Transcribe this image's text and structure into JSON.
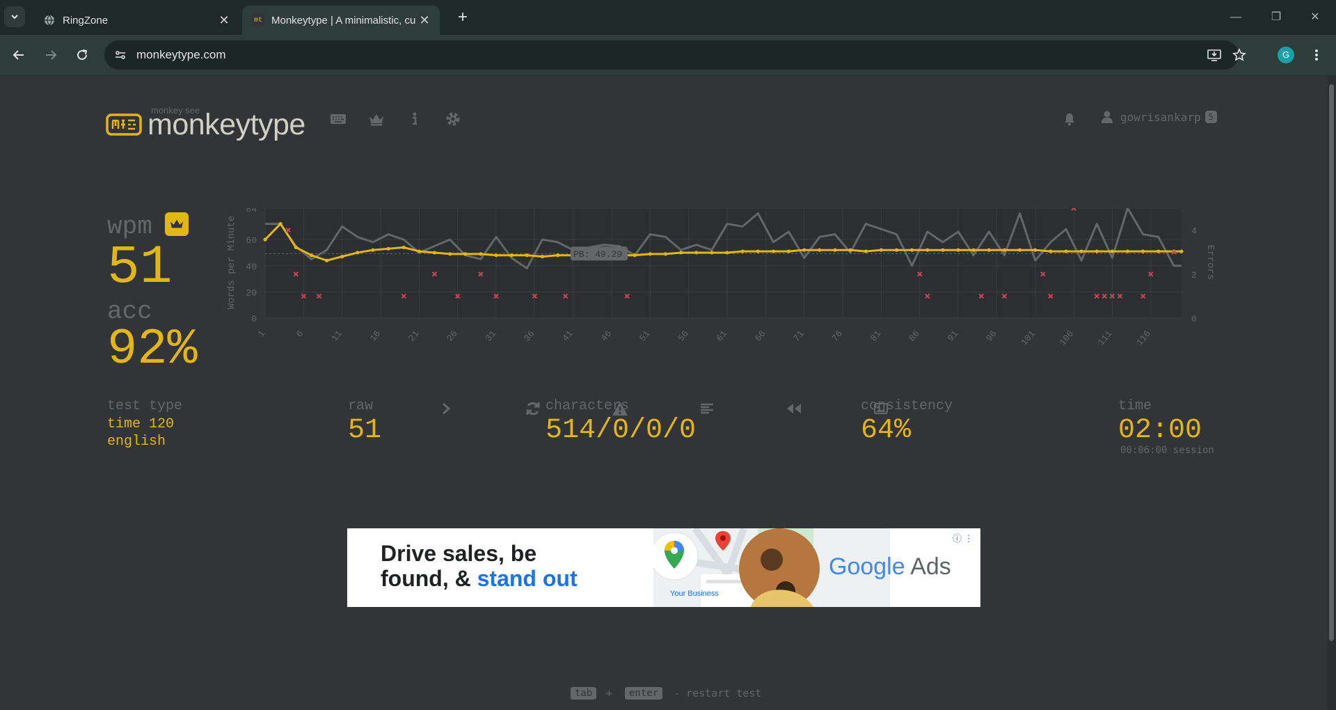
{
  "browser": {
    "tabs": [
      {
        "title": "RingZone",
        "active": false
      },
      {
        "title": "Monkeytype | A minimalistic, cu",
        "active": true,
        "favicon_text": "mt"
      }
    ],
    "new_tab_label": "+",
    "url": "monkeytype.com",
    "profile_initial": "G",
    "window_controls": {
      "minimize": "—",
      "restore": "❐",
      "close": "✕"
    }
  },
  "header": {
    "logo_top": "monkey see",
    "logo_text": "monkeytype",
    "nav_icons": [
      "keyboard-icon",
      "crown-icon",
      "info-icon",
      "gear-icon"
    ],
    "username": "gowrisankarp",
    "level": "5"
  },
  "result": {
    "wpm_label": "wpm",
    "wpm": "51",
    "acc_label": "acc",
    "acc": "92%",
    "test_type_label": "test type",
    "test_type_line1": "time 120",
    "test_type_line2": "english",
    "raw_label": "raw",
    "raw": "51",
    "characters_label": "characters",
    "characters": "514/0/0/0",
    "consistency_label": "consistency",
    "consistency": "64%",
    "time_label": "time",
    "time": "02:00",
    "session": "00:06:00 session"
  },
  "actions": [
    "next-test-icon",
    "restart-icon",
    "warning-icon",
    "words-list-icon",
    "replay-icon",
    "screenshot-icon"
  ],
  "ad": {
    "headline_line1": "Drive sales, be",
    "headline_line2a": "found, & ",
    "headline_line2b": "stand out",
    "your_business": "Your Business",
    "brand_google": "Google",
    "brand_ads": " Ads",
    "info": "ⓘ ⋮"
  },
  "footer": {
    "key1": "tab",
    "plus": "+",
    "key2": "enter",
    "hint": "- restart test"
  },
  "colors": {
    "background": "#323437",
    "main": "#e2b714",
    "sub": "#646669",
    "text": "#d1d0c5",
    "error": "#ca4754",
    "raw_line": "#646669"
  },
  "chart_data": {
    "type": "line",
    "ylabel": "Words per Minute",
    "y2label": "Errors",
    "ylim": [
      0,
      84
    ],
    "y_ticks": [
      "0",
      "20",
      "40",
      "60",
      "84"
    ],
    "y2lim": [
      0,
      5
    ],
    "y2_ticks": [
      "0",
      "2",
      "4"
    ],
    "xlim": [
      1,
      120
    ],
    "x_ticks": [
      "1",
      "6",
      "11",
      "16",
      "21",
      "26",
      "31",
      "36",
      "41",
      "46",
      "51",
      "56",
      "61",
      "66",
      "71",
      "76",
      "81",
      "86",
      "91",
      "96",
      "101",
      "106",
      "111",
      "116"
    ],
    "pb_label": "PB: 49.29",
    "pb_value": 49.29,
    "series": [
      {
        "name": "wpm",
        "x": [
          1,
          3,
          5,
          7,
          9,
          11,
          13,
          15,
          17,
          19,
          21,
          23,
          25,
          27,
          29,
          31,
          33,
          35,
          37,
          39,
          41,
          43,
          45,
          47,
          49,
          51,
          53,
          55,
          57,
          59,
          61,
          63,
          65,
          67,
          69,
          71,
          73,
          75,
          77,
          79,
          81,
          83,
          85,
          87,
          89,
          91,
          93,
          95,
          97,
          99,
          101,
          103,
          105,
          107,
          109,
          111,
          113,
          115,
          117,
          119,
          120
        ],
        "values": [
          60,
          72,
          54,
          48,
          44,
          47,
          50,
          52,
          53,
          54,
          51,
          50,
          49,
          49,
          49,
          48,
          48,
          48,
          47,
          48,
          48,
          48,
          48,
          48,
          48,
          49,
          49,
          50,
          50,
          50,
          50,
          51,
          51,
          51,
          51,
          52,
          52,
          52,
          52,
          51,
          52,
          52,
          52,
          52,
          52,
          52,
          52,
          52,
          52,
          52,
          52,
          51,
          51,
          51,
          51,
          51,
          51,
          51,
          51,
          51,
          51
        ]
      },
      {
        "name": "raw",
        "x": [
          1,
          3,
          5,
          7,
          9,
          11,
          13,
          15,
          17,
          19,
          21,
          23,
          25,
          27,
          29,
          31,
          33,
          35,
          37,
          39,
          41,
          43,
          45,
          47,
          49,
          51,
          53,
          55,
          57,
          59,
          61,
          63,
          65,
          67,
          69,
          71,
          73,
          75,
          77,
          79,
          81,
          83,
          85,
          87,
          89,
          91,
          93,
          95,
          97,
          99,
          101,
          103,
          105,
          107,
          109,
          111,
          113,
          115,
          117,
          119,
          120
        ],
        "values": [
          72,
          72,
          55,
          45,
          52,
          70,
          62,
          58,
          64,
          60,
          50,
          55,
          60,
          48,
          45,
          62,
          46,
          38,
          60,
          58,
          52,
          54,
          56,
          55,
          48,
          64,
          62,
          52,
          56,
          52,
          72,
          70,
          80,
          58,
          66,
          46,
          62,
          64,
          50,
          72,
          68,
          64,
          40,
          66,
          58,
          66,
          48,
          66,
          48,
          80,
          44,
          58,
          68,
          44,
          72,
          46,
          84,
          64,
          62,
          40,
          40
        ]
      }
    ],
    "errors": {
      "name": "errors",
      "x": [
        4,
        5,
        6,
        8,
        19,
        23,
        26,
        29,
        31,
        36,
        40,
        48,
        86,
        87,
        94,
        97,
        102,
        103,
        106,
        109,
        110,
        111,
        112,
        115,
        116,
        119
      ],
      "values": [
        4,
        2,
        1,
        1,
        1,
        2,
        1,
        2,
        1,
        1,
        1,
        1,
        2,
        1,
        1,
        1,
        2,
        1,
        5,
        1,
        1,
        1,
        1,
        1,
        2,
        3
      ]
    }
  }
}
